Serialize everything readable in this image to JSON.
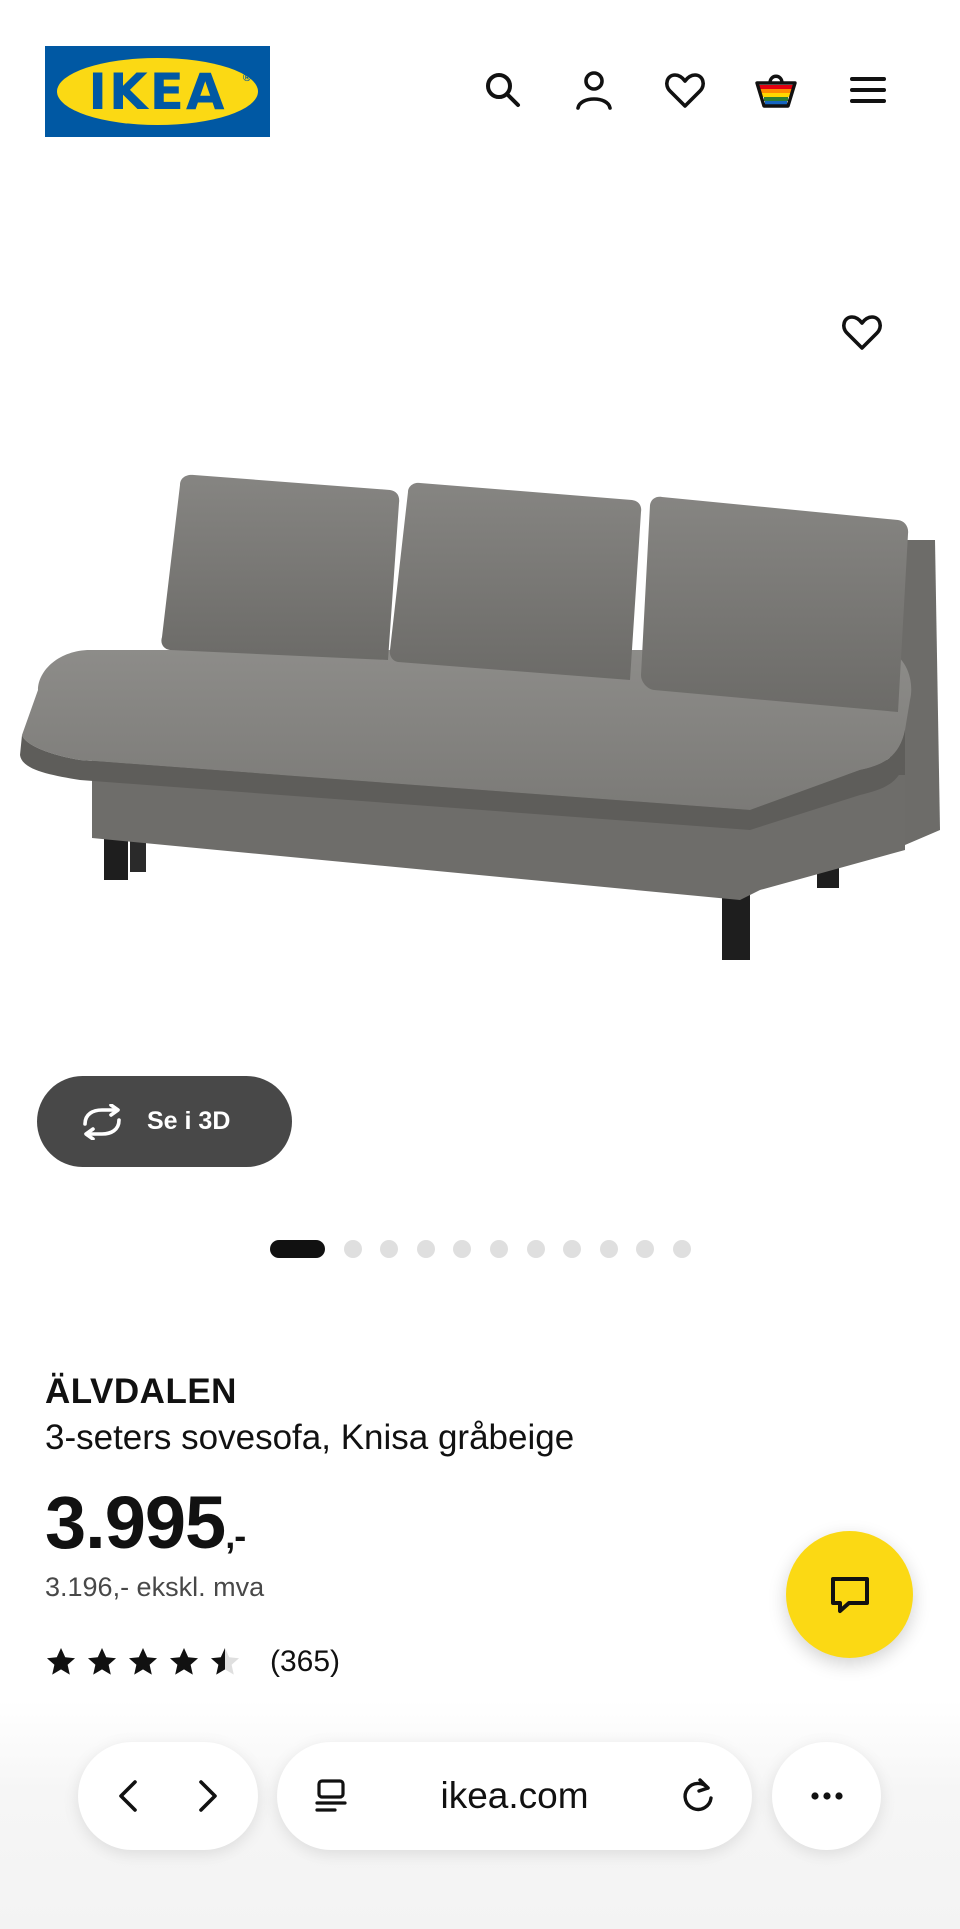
{
  "header": {
    "logo_text": "IKEA",
    "logo_registered": "®",
    "brand_colors": {
      "blue": "#0058A3",
      "yellow": "#FBD914"
    },
    "icons": [
      "search-icon",
      "account-icon",
      "favourites-icon",
      "cart-icon",
      "menu-icon"
    ]
  },
  "gallery": {
    "favourite_icon": "heart-icon",
    "view_3d_label": "Se i 3D",
    "view_3d_icon": "rotate-3d-icon",
    "image_count": 11,
    "active_index": 0
  },
  "product": {
    "name": "ÄLVDALEN",
    "description": "3-seters sovesofa, Knisa gråbeige",
    "price_main": "3.995",
    "price_suffix": ",-",
    "price_ex_vat": "3.196,- ekskl. mva",
    "rating_value": 4.5,
    "rating_max": 5,
    "review_count": "(365)"
  },
  "chat": {
    "icon": "chat-icon",
    "color": "#FBD914"
  },
  "browser": {
    "url": "ikea.com",
    "icons": [
      "back-icon",
      "forward-icon",
      "tabs-icon",
      "reload-icon",
      "more-icon"
    ]
  }
}
